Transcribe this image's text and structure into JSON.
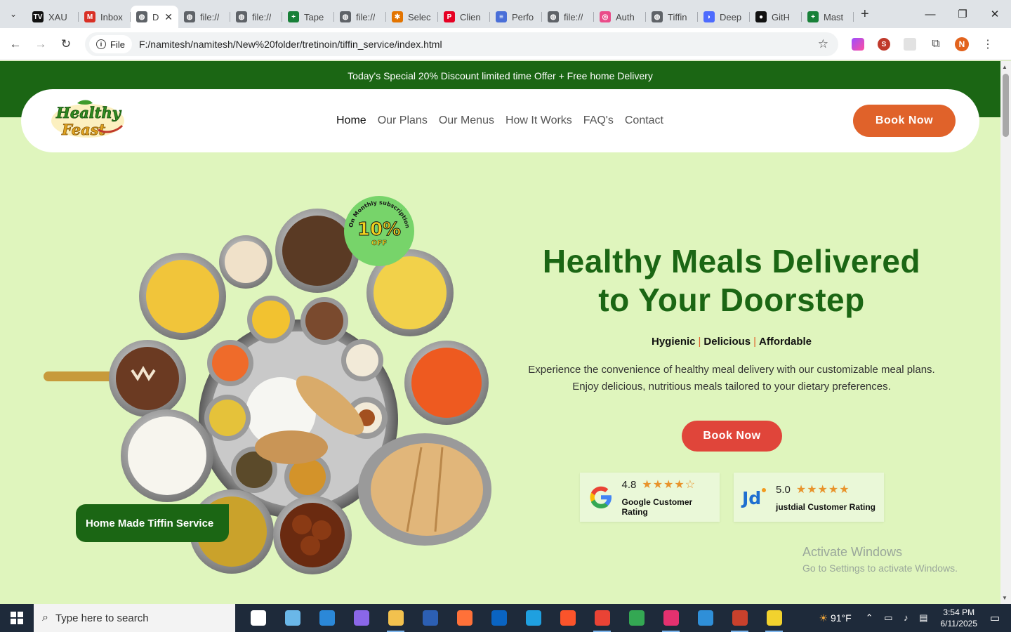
{
  "browser": {
    "tabs": [
      {
        "label": "XAU",
        "icon": "tradingview-icon",
        "color": "#111111",
        "glyph": "TV"
      },
      {
        "label": "Inbox",
        "icon": "gmail-icon",
        "color": "#d93025",
        "glyph": "M"
      },
      {
        "label": "D",
        "icon": "globe-icon",
        "color": "#5f6368",
        "glyph": "◍",
        "active": true
      },
      {
        "label": "file://",
        "icon": "globe-icon",
        "color": "#5f6368",
        "glyph": "◍"
      },
      {
        "label": "file://",
        "icon": "globe-icon",
        "color": "#5f6368",
        "glyph": "◍"
      },
      {
        "label": "Tape",
        "icon": "sheets-icon",
        "color": "#188038",
        "glyph": "+"
      },
      {
        "label": "file://",
        "icon": "globe-icon",
        "color": "#5f6368",
        "glyph": "◍"
      },
      {
        "label": "Selec",
        "icon": "app-icon",
        "color": "#e37400",
        "glyph": "✱"
      },
      {
        "label": "Clien",
        "icon": "pinterest-icon",
        "color": "#e60023",
        "glyph": "P"
      },
      {
        "label": "Perfo",
        "icon": "perf-icon",
        "color": "#4a6fd8",
        "glyph": "≡"
      },
      {
        "label": "file://",
        "icon": "globe-icon",
        "color": "#5f6368",
        "glyph": "◍"
      },
      {
        "label": "Auth",
        "icon": "dribbble-icon",
        "color": "#ea4c89",
        "glyph": "◎"
      },
      {
        "label": "Tiffin",
        "icon": "globe-icon",
        "color": "#5f6368",
        "glyph": "◍"
      },
      {
        "label": "Deep",
        "icon": "deepseek-icon",
        "color": "#4d6bfe",
        "glyph": "◗"
      },
      {
        "label": "GitH",
        "icon": "github-icon",
        "color": "#111111",
        "glyph": "●"
      },
      {
        "label": "Mast",
        "icon": "sheets-icon",
        "color": "#188038",
        "glyph": "+"
      }
    ],
    "address": {
      "scheme_label": "File",
      "url": "F:/namitesh/namitesh/New%20folder/tretinoin/tiffin_service/index.html"
    },
    "profile_initial": "N"
  },
  "page": {
    "promo": "Today's Special 20% Discount limited time Offer + Free home Delivery",
    "logo_text": [
      "Healthy",
      "Feast"
    ],
    "nav": [
      {
        "label": "Home",
        "active": true
      },
      {
        "label": "Our Plans"
      },
      {
        "label": "Our Menus"
      },
      {
        "label": "How It Works"
      },
      {
        "label": "FAQ's"
      },
      {
        "label": "Contact"
      }
    ],
    "book_nav": "Book Now",
    "badge": {
      "ring_text": "On Monthly subscription",
      "percent": "10%",
      "off": "OFF"
    },
    "tiffin_tag": "Home Made Tiffin Service",
    "hero_title_line1": "Healthy Meals Delivered",
    "hero_title_line2": "to Your Doorstep",
    "tagline": [
      "Hygienic",
      "Delicious",
      "Affordable"
    ],
    "tagline_sep": "|",
    "desc_line1": "Experience the convenience of healthy meal delivery with our customizable meal plans.",
    "desc_line2": "Enjoy delicious, nutritious meals tailored to your dietary preferences.",
    "book_hero": "Book Now",
    "ratings": [
      {
        "score": "4.8",
        "stars": 4.8,
        "stars_text": "★★★★☆",
        "label": "Google Customer Rating",
        "logo": "google-icon"
      },
      {
        "score": "5.0",
        "stars": 5.0,
        "stars_text": "★★★★★",
        "label": "justdial Customer Rating",
        "logo": "justdial-icon",
        "logo_text": "Jd"
      }
    ],
    "watermark_line1": "Activate Windows",
    "watermark_line2": "Go to Settings to activate Windows."
  },
  "taskbar": {
    "search_placeholder": "Type here to search",
    "weather": "91°F",
    "time": "3:54 PM",
    "date": "6/11/2025",
    "apps": [
      {
        "name": "task-view-icon",
        "color": "#ffffff"
      },
      {
        "name": "notepad-icon",
        "color": "#6ab7e8"
      },
      {
        "name": "store-icon",
        "color": "#2b88d8"
      },
      {
        "name": "copilot-icon",
        "color": "#8a67e8"
      },
      {
        "name": "file-explorer-icon",
        "color": "#f2c14e",
        "running": true
      },
      {
        "name": "powershell-icon",
        "color": "#2c5fb3"
      },
      {
        "name": "firefox-icon",
        "color": "#ff7139"
      },
      {
        "name": "outlook-icon",
        "color": "#0a64c2"
      },
      {
        "name": "edge-icon",
        "color": "#1fa0e0"
      },
      {
        "name": "brave-icon",
        "color": "#fb542b"
      },
      {
        "name": "chrome-profile-icon",
        "color": "#ea4335",
        "running": true
      },
      {
        "name": "chrome-icon",
        "color": "#34a853"
      },
      {
        "name": "intellij-icon",
        "color": "#e4316f",
        "running": true
      },
      {
        "name": "vscode-icon",
        "color": "#2f8fd8"
      },
      {
        "name": "chrome-profile-2-icon",
        "color": "#c9412c",
        "running": true
      },
      {
        "name": "notes-icon",
        "color": "#f2d22e",
        "running": true
      }
    ]
  },
  "colors": {
    "brand_green": "#1b6614",
    "accent_orange": "#e0622a",
    "accent_red": "#e0453a",
    "page_bg": "#dff5bd",
    "star": "#e8932b"
  }
}
